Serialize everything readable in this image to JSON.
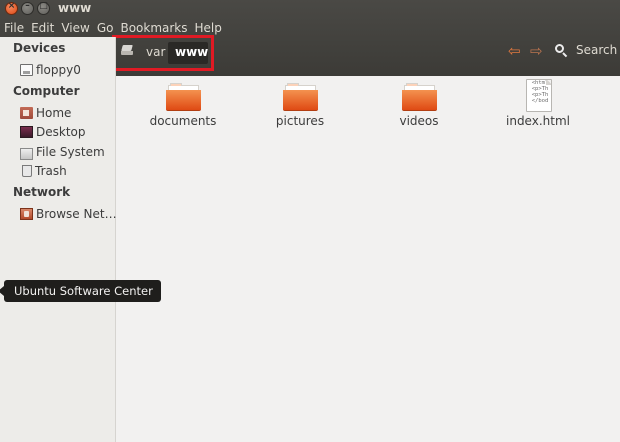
{
  "window": {
    "title": "www"
  },
  "menu": [
    "File",
    "Edit",
    "View",
    "Go",
    "Bookmarks",
    "Help"
  ],
  "sidebar": {
    "sections": [
      {
        "title": "Devices",
        "items": [
          {
            "label": "floppy0",
            "icon": "floppy-icon"
          }
        ]
      },
      {
        "title": "Computer",
        "items": [
          {
            "label": "Home",
            "icon": "home-folder-icon"
          },
          {
            "label": "Desktop",
            "icon": "desktop-icon"
          },
          {
            "label": "File System",
            "icon": "filesystem-icon"
          },
          {
            "label": "Trash",
            "icon": "trash-icon"
          }
        ]
      },
      {
        "title": "Network",
        "items": [
          {
            "label": "Browse Net…",
            "icon": "network-icon"
          }
        ]
      }
    ]
  },
  "path": {
    "crumbs": [
      "var",
      "www"
    ],
    "current": "www",
    "drive_icon": "drive-icon"
  },
  "toolbar": {
    "search_label": "Search",
    "back_icon": "back-arrow-icon",
    "forward_icon": "forward-arrow-icon"
  },
  "files": [
    {
      "name": "documents",
      "type": "folder"
    },
    {
      "name": "pictures",
      "type": "folder"
    },
    {
      "name": "videos",
      "type": "folder"
    },
    {
      "name": "index.html",
      "type": "html",
      "preview": [
        "<html",
        "<p>Th",
        "<p>Th",
        "</bod"
      ]
    }
  ],
  "tooltip": {
    "text": "Ubuntu Software Center"
  },
  "colors": {
    "accent": "#dd4814",
    "highlight_box": "#e01a24",
    "folder": "#ef7a3c",
    "topbar": "#3c3b37"
  }
}
